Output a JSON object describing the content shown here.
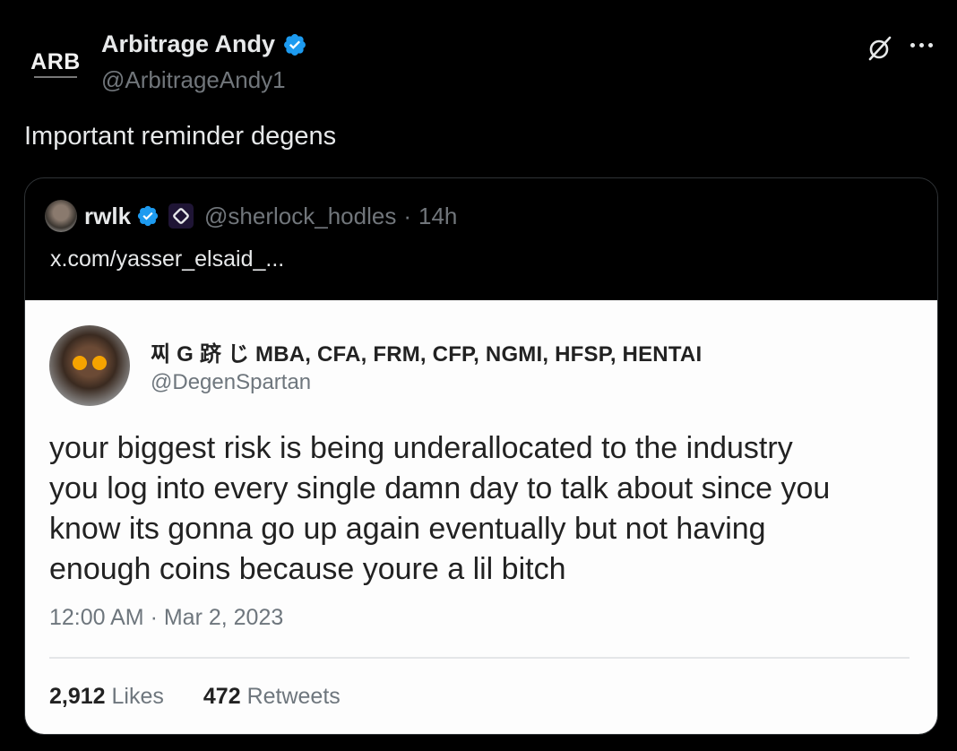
{
  "tweet": {
    "avatar_text": "ARB",
    "author_name": "Arbitrage Andy",
    "author_handle": "@ArbitrageAndy1",
    "text": "Important reminder degens",
    "icons": [
      "verified-badge-icon",
      "grok-icon",
      "more-icon"
    ]
  },
  "quote": {
    "author_name": "rwlk",
    "author_handle": "@sherlock_hodles",
    "separator": "·",
    "age": "14h",
    "link_text": "x.com/yasser_elsaid_...",
    "icons": [
      "verified-badge-icon",
      "affiliate-badge-icon"
    ]
  },
  "screenshot_card": {
    "display_name": "찌 G 跻 じ MBA, CFA, FRM, CFP, NGMI, HFSP, HENTAI",
    "handle": "@DegenSpartan",
    "body_lines": [
      "your biggest risk is being underallocated to the industry",
      "you log into every single damn day to talk about since you",
      "know its gonna go up again eventually but not having",
      "enough coins because youre a lil bitch"
    ],
    "timestamp": "12:00 AM · Mar 2, 2023",
    "likes_count": "2,912",
    "likes_label": "Likes",
    "retweets_count": "472",
    "retweets_label": "Retweets"
  },
  "colors": {
    "background": "#000000",
    "text_primary": "#e7e9ea",
    "text_secondary": "#71767b",
    "verified_blue": "#1d9bf0",
    "card_background": "#fdfdfd"
  }
}
